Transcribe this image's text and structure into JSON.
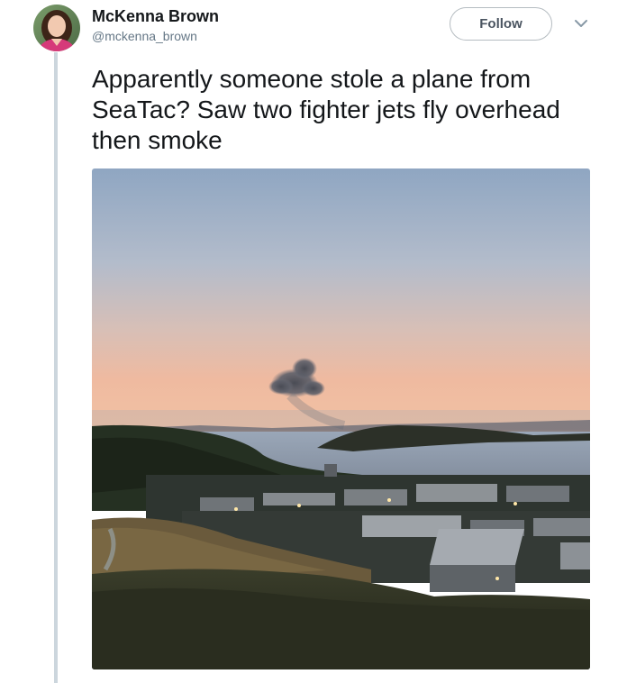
{
  "tweet": {
    "author": {
      "display_name": "McKenna Brown",
      "handle": "@mckenna_brown",
      "avatar_icon": "profile-photo"
    },
    "follow_label": "Follow",
    "menu_icon": "chevron-down-icon",
    "text": "Apparently someone stole a plane from SeaTac? Saw two fighter jets fly overhead then smoke",
    "media": {
      "type": "photo",
      "subject": "smoke cloud over water at dusk seen from hillside"
    }
  },
  "colors": {
    "text_primary": "#14171a",
    "text_secondary": "#657786",
    "thread_line": "#ccd6dd",
    "button_border": "#b5bcc1"
  }
}
